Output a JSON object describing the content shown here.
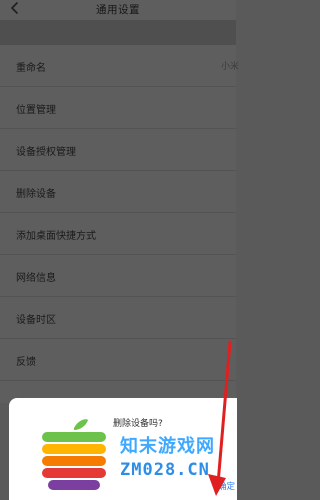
{
  "header": {
    "title": "通用设置"
  },
  "settings": {
    "rows": [
      {
        "label": "重命名",
        "value": "小米"
      },
      {
        "label": "位置管理"
      },
      {
        "label": "设备授权管理"
      },
      {
        "label": "删除设备"
      },
      {
        "label": "添加桌面快捷方式"
      },
      {
        "label": "网络信息"
      },
      {
        "label": "设备时区"
      },
      {
        "label": "反馈"
      }
    ]
  },
  "dialog": {
    "message": "删除设备吗?",
    "confirm_label": "确定"
  },
  "watermark": {
    "text_cn": "知末游戏网",
    "text_en": "ZM028.CN"
  },
  "colors": {
    "accent": "#2e7be6",
    "overlay": "#5e5e5e",
    "arrow": "#e02020"
  }
}
